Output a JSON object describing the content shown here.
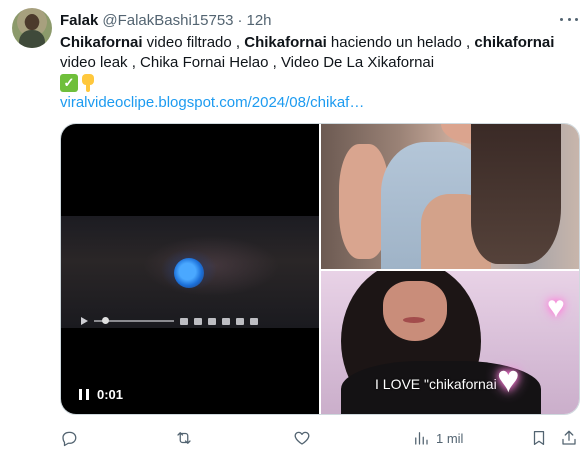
{
  "tweet": {
    "author_name": "Falak",
    "handle": "@FalakBashi15753",
    "separator": "·",
    "time": "12h",
    "text_parts": [
      {
        "bold": true,
        "text": "Chikafornai"
      },
      {
        "bold": false,
        "text": " video filtrado , "
      },
      {
        "bold": true,
        "text": "Chikafornai"
      },
      {
        "bold": false,
        "text": " haciendo un helado , "
      },
      {
        "bold": true,
        "text": "chikafornai"
      },
      {
        "bold": false,
        "text": " video leak , Chika Fornai Helao , Video De La Xikafornai"
      }
    ],
    "emojis": [
      "check-mark-emoji",
      "pointing-down-emoji"
    ],
    "link": "viralvideoclipe.blogspot.com/2024/08/chikaf…"
  },
  "media": {
    "video_time": "0:01",
    "photo_caption": "I LOVE \"chikafornai"
  },
  "actions": {
    "views": "1 mil"
  }
}
